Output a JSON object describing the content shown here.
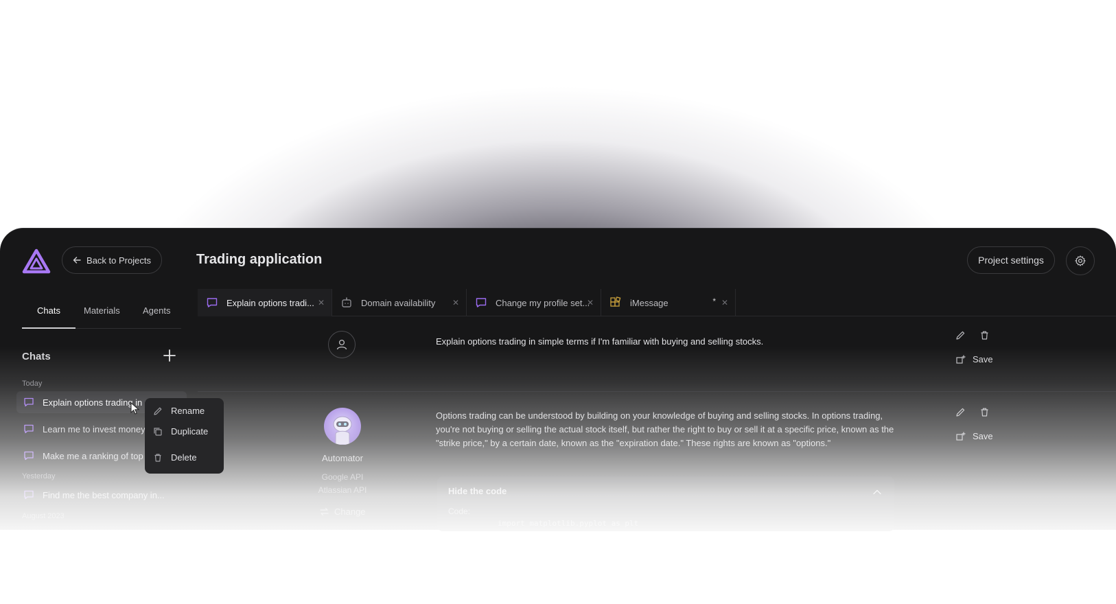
{
  "header": {
    "back_label": "Back to Projects",
    "title": "Trading application",
    "project_settings_label": "Project settings",
    "accent_color": "#9b6cf0"
  },
  "sidebar": {
    "tabs": [
      "Chats",
      "Materials",
      "Agents"
    ],
    "active_tab": "Chats",
    "section_title": "Chats",
    "groups": {
      "today": "Today",
      "yesterday": "Yesterday",
      "older": "August 2023"
    },
    "items": [
      "Explain options trading in s",
      "Learn me to invest money c",
      "Make me a ranking of top i",
      "Find me the best company in..."
    ]
  },
  "context_menu": {
    "items": [
      "Rename",
      "Duplicate",
      "Delete"
    ]
  },
  "tabs": [
    {
      "label": "Explain options tradi...",
      "icon": "chat-icon"
    },
    {
      "label": "Domain availability",
      "icon": "robot-icon"
    },
    {
      "label": "Change my profile set...",
      "icon": "chat-icon"
    },
    {
      "label": "iMessage",
      "icon": "apps-icon",
      "modified_marker": "*"
    }
  ],
  "messages": {
    "user_text": "Explain options trading in simple terms if I'm familiar with buying and selling stocks.",
    "save_label": "Save",
    "bot_name": "Automator",
    "bot_apis": [
      "Google API",
      "Atlassian API"
    ],
    "bot_change_label": "Change",
    "bot_text": "Options trading can be understood by building on your knowledge of buying and selling stocks. In options trading, you're not buying or selling the actual stock itself, but rather the right to buy or sell it at a specific price, known as the \"strike price,\" by a certain date, known as the \"expiration date.\" These rights are known as \"options.\"",
    "code_toggle_label": "Hide the code",
    "code_label": "Code:",
    "code_line": "import matplotlib.pyplot as plt"
  }
}
